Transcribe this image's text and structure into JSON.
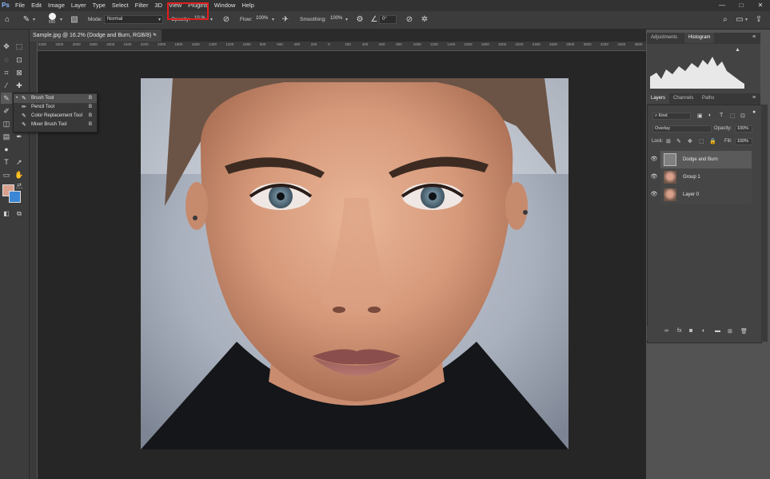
{
  "menu": {
    "logo": "Ps",
    "items": [
      "File",
      "Edit",
      "Image",
      "Layer",
      "Type",
      "Select",
      "Filter",
      "3D",
      "View",
      "Plugins",
      "Window",
      "Help"
    ],
    "window_controls": [
      "—",
      "□",
      "✕"
    ]
  },
  "options": {
    "brush_size": "500",
    "mode_label": "Mode:",
    "mode_value": "Normal",
    "opacity_label": "Opacity:",
    "opacity_value": "10 %",
    "flow_label": "Flow:",
    "flow_value": "100%",
    "smoothing_label": "Smoothing:",
    "smoothing_value": "100%",
    "angle_value": "0°"
  },
  "document": {
    "tab_title": "Sample.jpg @ 16.2% (Dodge and Burn, RGB/8) *",
    "close": "×"
  },
  "ruler": {
    "ticks": [
      "3400",
      "3200",
      "3000",
      "2800",
      "2600",
      "2400",
      "2200",
      "2000",
      "1800",
      "1600",
      "1400",
      "1200",
      "1000",
      "800",
      "600",
      "400",
      "200",
      "0",
      "200",
      "400",
      "600",
      "800",
      "1000",
      "1200",
      "1400",
      "1600",
      "1800",
      "2000",
      "2200",
      "2400",
      "2600",
      "2800",
      "3000",
      "3200",
      "3400",
      "3600",
      "3800"
    ]
  },
  "flyout": {
    "items": [
      {
        "icon": "✎",
        "label": "Brush Tool",
        "key": "B"
      },
      {
        "icon": "✏",
        "label": "Pencil Tool",
        "key": "B"
      },
      {
        "icon": "✎",
        "label": "Color Replacement Tool",
        "key": "B"
      },
      {
        "icon": "✎",
        "label": "Mixer Brush Tool",
        "key": "B"
      }
    ]
  },
  "colors": {
    "foreground": "#d9a08c",
    "background": "#3b87d6",
    "highlight": "#e21e1e"
  },
  "panels": {
    "top_tabs": [
      "Adjustments",
      "Histogram"
    ],
    "layer_tabs": [
      "Layers",
      "Channels",
      "Paths"
    ],
    "kind_label": "Kind",
    "blend_mode": "Overlay",
    "opacity_label": "Opacity:",
    "opacity_value": "100%",
    "lock_label": "Lock:",
    "fill_label": "Fill:",
    "fill_value": "100%",
    "layers": [
      {
        "name": "Dodge and Burn",
        "visible": "👁"
      },
      {
        "name": "Group 1",
        "visible": "👁"
      },
      {
        "name": "Layer 0",
        "visible": "👁"
      }
    ],
    "footer_icons": [
      "link-icon",
      "fx-icon",
      "mask-icon",
      "adjustment-icon",
      "folder-icon",
      "new-layer-icon",
      "trash-icon"
    ]
  }
}
